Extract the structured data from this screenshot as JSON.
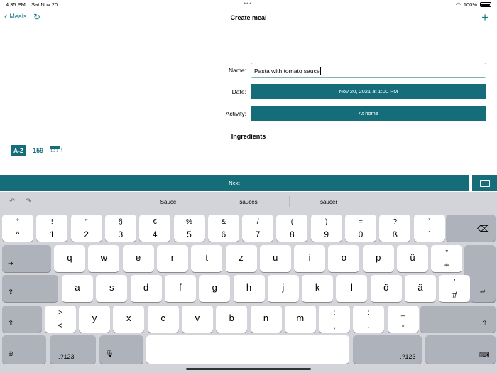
{
  "status": {
    "time": "4:35 PM",
    "date": "Sat Nov 20",
    "battery": "100%"
  },
  "nav": {
    "back_label": "Meals",
    "title": "Create meal"
  },
  "form": {
    "name_label": "Name:",
    "name_value": "Pasta with tomato sauce",
    "date_label": "Date:",
    "date_value": "Nov 20, 2021 at 1:00 PM",
    "activity_label": "Activity:",
    "activity_value": "At home"
  },
  "ingredients": {
    "title": "Ingredients",
    "sort_az": "A-Z",
    "sort_159": "159",
    "sort_icon_nums": "1 2 3"
  },
  "next_label": "Next",
  "suggestions": [
    "Sauce",
    "sauces",
    "saucer"
  ],
  "keys": {
    "row1": [
      {
        "sym": "°",
        "dig": "^"
      },
      {
        "sym": "!",
        "dig": "1"
      },
      {
        "sym": "″",
        "dig": "2"
      },
      {
        "sym": "§",
        "dig": "3"
      },
      {
        "sym": "€",
        "dig": "4"
      },
      {
        "sym": "%",
        "dig": "5"
      },
      {
        "sym": "&",
        "dig": "6"
      },
      {
        "sym": "/",
        "dig": "7"
      },
      {
        "sym": "(",
        "dig": "8"
      },
      {
        "sym": ")",
        "dig": "9"
      },
      {
        "sym": "=",
        "dig": "0"
      },
      {
        "sym": "?",
        "dig": "ß"
      },
      {
        "sym": "`",
        "dig": "´"
      }
    ],
    "row2": [
      "q",
      "w",
      "e",
      "r",
      "t",
      "z",
      "u",
      "i",
      "o",
      "p",
      "ü"
    ],
    "row2_last": {
      "sym": "*",
      "dig": "+"
    },
    "row3": [
      "a",
      "s",
      "d",
      "f",
      "g",
      "h",
      "j",
      "k",
      "l",
      "ö",
      "ä"
    ],
    "row3_last": {
      "sym": "’",
      "dig": "#"
    },
    "row4_first": {
      "sym": ">",
      "dig": "<"
    },
    "row4": [
      "y",
      "x",
      "c",
      "v",
      "b",
      "n",
      "m"
    ],
    "row4_punct": [
      {
        "sym": ";",
        "dig": ","
      },
      {
        "sym": ":",
        "dig": "."
      },
      {
        "sym": "_",
        "dig": "-"
      }
    ],
    "mode_label": ".?123"
  }
}
